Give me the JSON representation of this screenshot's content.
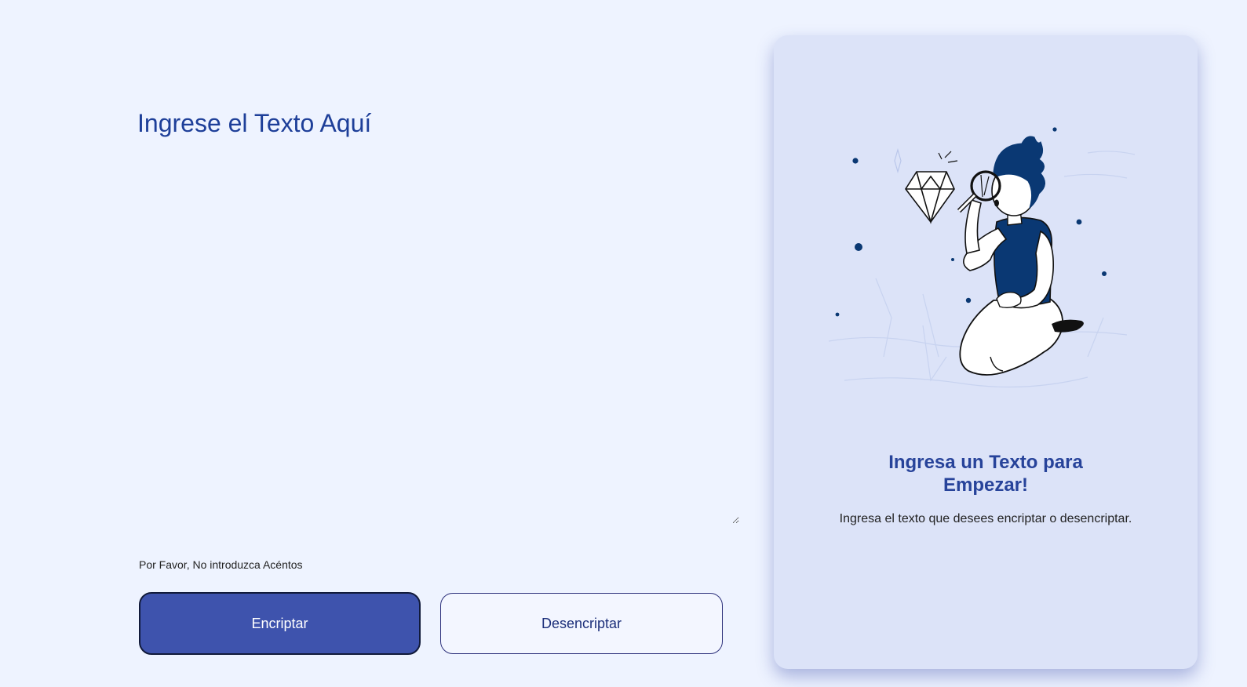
{
  "input": {
    "placeholder": "Ingrese el Texto Aquí",
    "value": ""
  },
  "warning": {
    "text": "Por Favor, No introduzca Acéntos"
  },
  "buttons": {
    "encrypt_label": "Encriptar",
    "decrypt_label": "Desencriptar"
  },
  "output_panel": {
    "title": "Ingresa un Texto para Empezar!",
    "subtitle": "Ingresa el texto que desees encriptar o desencriptar.",
    "illustration": "person-with-magnifying-glass-inspecting-diamond"
  },
  "colors": {
    "page_background": "#eef3ff",
    "accent_blue": "#3e53ad",
    "panel_background": "#dce3f8",
    "title_blue": "#27439a",
    "figure_navy": "#0a3873"
  }
}
